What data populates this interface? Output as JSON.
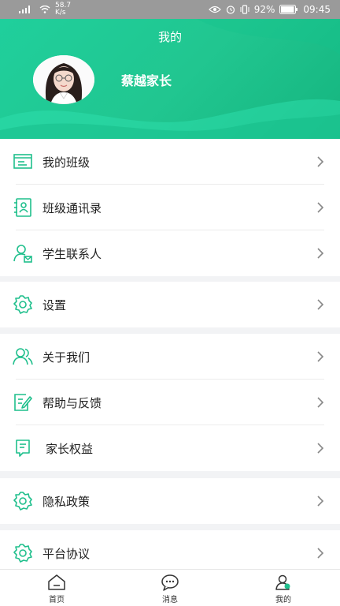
{
  "status_bar": {
    "network_speed": "58.7",
    "speed_unit": "K/s",
    "battery": "92%",
    "time": "09:45"
  },
  "header": {
    "title": "我的",
    "username": "蔡越家长"
  },
  "menu": {
    "my_class": "我的班级",
    "class_contacts": "班级通讯录",
    "student_contacts": "学生联系人",
    "settings": "设置",
    "about_us": "关于我们",
    "help_feedback": "帮助与反馈",
    "parent_rights": "家长权益",
    "privacy_policy": "隐私政策",
    "platform_agreement": "平台协议"
  },
  "tabbar": {
    "home": "首页",
    "messages": "消息",
    "mine": "我的"
  },
  "colors": {
    "accent": "#1fc08c",
    "header_gradient_start": "#1fd09d",
    "header_gradient_end": "#15b57f"
  }
}
